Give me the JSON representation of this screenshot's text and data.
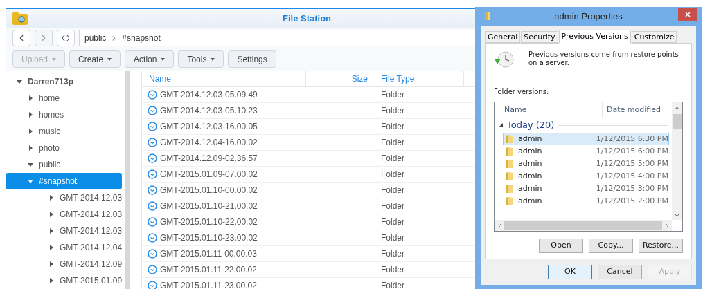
{
  "file_station": {
    "title": "File Station",
    "path": [
      "public",
      "#snapshot"
    ],
    "toolbar": [
      {
        "label": "Upload",
        "menu": true,
        "disabled": true
      },
      {
        "label": "Create",
        "menu": true,
        "disabled": false
      },
      {
        "label": "Action",
        "menu": true,
        "disabled": false
      },
      {
        "label": "Tools",
        "menu": true,
        "disabled": false
      },
      {
        "label": "Settings",
        "menu": false,
        "disabled": false
      }
    ],
    "tree": [
      {
        "label": "Darren713p",
        "expanded": true,
        "selected": false,
        "children": [
          {
            "label": "home",
            "expanded": false,
            "selected": false
          },
          {
            "label": "homes",
            "expanded": false,
            "selected": false
          },
          {
            "label": "music",
            "expanded": false,
            "selected": false
          },
          {
            "label": "photo",
            "expanded": false,
            "selected": false
          },
          {
            "label": "public",
            "expanded": true,
            "selected": false,
            "children": [
              {
                "label": "#snapshot",
                "expanded": true,
                "selected": true,
                "children": [
                  {
                    "label": "GMT-2014.12.03",
                    "expanded": false,
                    "selected": false
                  },
                  {
                    "label": "GMT-2014.12.03",
                    "expanded": false,
                    "selected": false
                  },
                  {
                    "label": "GMT-2014.12.03",
                    "expanded": false,
                    "selected": false
                  },
                  {
                    "label": "GMT-2014.12.04",
                    "expanded": false,
                    "selected": false
                  },
                  {
                    "label": "GMT-2014.12.09",
                    "expanded": false,
                    "selected": false
                  },
                  {
                    "label": "GMT-2015.01.09",
                    "expanded": false,
                    "selected": false
                  }
                ]
              }
            ]
          }
        ]
      }
    ],
    "table": {
      "columns": [
        "Name",
        "Size",
        "File Type"
      ],
      "rows": [
        {
          "name": "GMT-2014.12.03-05.09.49",
          "type": "Folder"
        },
        {
          "name": "GMT-2014.12.03-05.10.23",
          "type": "Folder"
        },
        {
          "name": "GMT-2014.12.03-16.00.05",
          "type": "Folder"
        },
        {
          "name": "GMT-2014.12.04-16.00.02",
          "type": "Folder"
        },
        {
          "name": "GMT-2014.12.09-02.36.57",
          "type": "Folder"
        },
        {
          "name": "GMT-2015.01.09-07.00.02",
          "type": "Folder"
        },
        {
          "name": "GMT-2015.01.10-00.00.02",
          "type": "Folder"
        },
        {
          "name": "GMT-2015.01.10-21.00.02",
          "type": "Folder"
        },
        {
          "name": "GMT-2015.01.10-22.00.02",
          "type": "Folder"
        },
        {
          "name": "GMT-2015.01.10-23.00.02",
          "type": "Folder"
        },
        {
          "name": "GMT-2015.01.11-00.00.03",
          "type": "Folder"
        },
        {
          "name": "GMT-2015.01.11-22.00.02",
          "type": "Folder"
        },
        {
          "name": "GMT-2015.01.11-23.00.02",
          "type": "Folder"
        }
      ]
    }
  },
  "dialog": {
    "title": "admin Properties",
    "tabs": [
      {
        "label": "General",
        "selected": false
      },
      {
        "label": "Security",
        "selected": false
      },
      {
        "label": "Previous Versions",
        "selected": true
      },
      {
        "label": "Customize",
        "selected": false
      }
    ],
    "info": "Previous versions come from restore points on a server.",
    "list_label": "Folder versions:",
    "columns": [
      "Name",
      "Date modified"
    ],
    "group": {
      "label": "Today (20)",
      "expanded": true
    },
    "versions": [
      {
        "name": "admin",
        "date": "1/12/2015 6:30 PM",
        "selected": true
      },
      {
        "name": "admin",
        "date": "1/12/2015 6:00 PM",
        "selected": false
      },
      {
        "name": "admin",
        "date": "1/12/2015 5:00 PM",
        "selected": false
      },
      {
        "name": "admin",
        "date": "1/12/2015 4:00 PM",
        "selected": false
      },
      {
        "name": "admin",
        "date": "1/12/2015 3:00 PM",
        "selected": false
      },
      {
        "name": "admin",
        "date": "1/12/2015 2:00 PM",
        "selected": false
      }
    ],
    "list_buttons": [
      {
        "label": "Open",
        "disabled": false
      },
      {
        "label": "Copy...",
        "disabled": false
      },
      {
        "label": "Restore...",
        "disabled": false
      }
    ],
    "buttons": [
      {
        "label": "OK",
        "default": true,
        "disabled": false
      },
      {
        "label": "Cancel",
        "default": false,
        "disabled": false
      },
      {
        "label": "Apply",
        "default": false,
        "disabled": true
      }
    ]
  }
}
